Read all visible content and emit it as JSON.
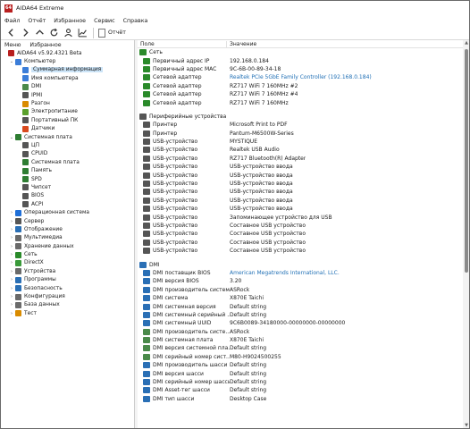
{
  "window": {
    "title": "AIDA64 Extreme"
  },
  "menubar": [
    "Файл",
    "Отчёт",
    "Избранное",
    "Сервис",
    "Справка"
  ],
  "toolbar": {
    "report_label": "Отчёт"
  },
  "left_panel": {
    "tabs": [
      "Меню",
      "Избранное"
    ],
    "tree": [
      {
        "label": "AIDA64 v5.92.4321 Beta",
        "indent": 0,
        "expander": "",
        "color": "#b81f1f",
        "selected": false
      },
      {
        "label": "Компьютер",
        "indent": 1,
        "expander": "⌄",
        "color": "#3b7dd8",
        "selected": false
      },
      {
        "label": "Суммарная информация",
        "indent": 2,
        "expander": "",
        "color": "#3b7dd8",
        "selected": true
      },
      {
        "label": "Имя компьютера",
        "indent": 2,
        "expander": "",
        "color": "#3b7dd8",
        "selected": false
      },
      {
        "label": "DMI",
        "indent": 2,
        "expander": "",
        "color": "#4a8a4a",
        "selected": false
      },
      {
        "label": "IPMI",
        "indent": 2,
        "expander": "",
        "color": "#555555",
        "selected": false
      },
      {
        "label": "Разгон",
        "indent": 2,
        "expander": "",
        "color": "#d98b00",
        "selected": false
      },
      {
        "label": "Электропитание",
        "indent": 2,
        "expander": "",
        "color": "#5aa02c",
        "selected": false
      },
      {
        "label": "Портативный ПК",
        "indent": 2,
        "expander": "",
        "color": "#555555",
        "selected": false
      },
      {
        "label": "Датчики",
        "indent": 2,
        "expander": "",
        "color": "#d94a1f",
        "selected": false
      },
      {
        "label": "Системная плата",
        "indent": 1,
        "expander": "⌄",
        "color": "#2e7d32",
        "selected": false
      },
      {
        "label": "ЦП",
        "indent": 2,
        "expander": "",
        "color": "#555555",
        "selected": false
      },
      {
        "label": "CPUID",
        "indent": 2,
        "expander": "",
        "color": "#555555",
        "selected": false
      },
      {
        "label": "Системная плата",
        "indent": 2,
        "expander": "",
        "color": "#2e7d32",
        "selected": false
      },
      {
        "label": "Память",
        "indent": 2,
        "expander": "",
        "color": "#2e7d32",
        "selected": false
      },
      {
        "label": "SPD",
        "indent": 2,
        "expander": "",
        "color": "#2e7d32",
        "selected": false
      },
      {
        "label": "Чипсет",
        "indent": 2,
        "expander": "",
        "color": "#555555",
        "selected": false
      },
      {
        "label": "BIOS",
        "indent": 2,
        "expander": "",
        "color": "#555555",
        "selected": false
      },
      {
        "label": "ACPI",
        "indent": 2,
        "expander": "",
        "color": "#555555",
        "selected": false
      },
      {
        "label": "Операционная система",
        "indent": 1,
        "expander": "›",
        "color": "#1f6fd8",
        "selected": false
      },
      {
        "label": "Сервер",
        "indent": 1,
        "expander": "›",
        "color": "#555555",
        "selected": false
      },
      {
        "label": "Отображение",
        "indent": 1,
        "expander": "›",
        "color": "#2a6fb5",
        "selected": false
      },
      {
        "label": "Мультимедиа",
        "indent": 1,
        "expander": "›",
        "color": "#6a6a6a",
        "selected": false
      },
      {
        "label": "Хранение данных",
        "indent": 1,
        "expander": "›",
        "color": "#6a6a6a",
        "selected": false
      },
      {
        "label": "Сеть",
        "indent": 1,
        "expander": "›",
        "color": "#2a8a2a",
        "selected": false
      },
      {
        "label": "DirectX",
        "indent": 1,
        "expander": "›",
        "color": "#3a9a3a",
        "selected": false
      },
      {
        "label": "Устройства",
        "indent": 1,
        "expander": "›",
        "color": "#6a6a6a",
        "selected": false
      },
      {
        "label": "Программы",
        "indent": 1,
        "expander": "›",
        "color": "#2a6fb5",
        "selected": false
      },
      {
        "label": "Безопасность",
        "indent": 1,
        "expander": "›",
        "color": "#2a6fb5",
        "selected": false
      },
      {
        "label": "Конфигурация",
        "indent": 1,
        "expander": "›",
        "color": "#6a6a6a",
        "selected": false
      },
      {
        "label": "База данных",
        "indent": 1,
        "expander": "›",
        "color": "#6a6a6a",
        "selected": false
      },
      {
        "label": "Тест",
        "indent": 1,
        "expander": "›",
        "color": "#d98b00",
        "selected": false
      }
    ]
  },
  "table": {
    "col_field": "Поле",
    "col_value": "Значение",
    "sections": [
      {
        "title": "Сеть",
        "color": "#2a8a2a",
        "rows": [
          {
            "field": "Первичный адрес IP",
            "value": "192.168.0.184",
            "link": false,
            "color": "#2a8a2a"
          },
          {
            "field": "Первичный адрес MAC",
            "value": "9C-6B-00-89-34-18",
            "link": false,
            "color": "#2a8a2a"
          },
          {
            "field": "Сетевой адаптер",
            "value": "Realtek PCIe 5GbE Family Controller  (192.168.0.184)",
            "link": true,
            "color": "#2a8a2a"
          },
          {
            "field": "Сетевой адаптер",
            "value": "RZ717 WiFi 7 160MHz #2",
            "link": false,
            "color": "#2a8a2a"
          },
          {
            "field": "Сетевой адаптер",
            "value": "RZ717 WiFi 7 160MHz #4",
            "link": false,
            "color": "#2a8a2a"
          },
          {
            "field": "Сетевой адаптер",
            "value": "RZ717 WiFi 7 160MHz",
            "link": false,
            "color": "#2a8a2a"
          }
        ]
      },
      {
        "title": "Периферийные устройства",
        "color": "#555555",
        "rows": [
          {
            "field": "Принтер",
            "value": "Microsoft Print to PDF",
            "link": false,
            "color": "#555555"
          },
          {
            "field": "Принтер",
            "value": "Pantum-M6500W-Series",
            "link": false,
            "color": "#555555"
          },
          {
            "field": "USB-устройство",
            "value": "MYSTIQUE",
            "link": false,
            "color": "#555555"
          },
          {
            "field": "USB-устройство",
            "value": "Realtek USB Audio",
            "link": false,
            "color": "#555555"
          },
          {
            "field": "USB-устройство",
            "value": "RZ717 Bluetooth(R) Adapter",
            "link": false,
            "color": "#555555"
          },
          {
            "field": "USB-устройство",
            "value": "USB-устройство ввода",
            "link": false,
            "color": "#555555"
          },
          {
            "field": "USB-устройство",
            "value": "USB-устройство ввода",
            "link": false,
            "color": "#555555"
          },
          {
            "field": "USB-устройство",
            "value": "USB-устройство ввода",
            "link": false,
            "color": "#555555"
          },
          {
            "field": "USB-устройство",
            "value": "USB-устройство ввода",
            "link": false,
            "color": "#555555"
          },
          {
            "field": "USB-устройство",
            "value": "USB-устройство ввода",
            "link": false,
            "color": "#555555"
          },
          {
            "field": "USB-устройство",
            "value": "USB-устройство ввода",
            "link": false,
            "color": "#555555"
          },
          {
            "field": "USB-устройство",
            "value": "Запоминающее устройство для USB",
            "link": false,
            "color": "#555555"
          },
          {
            "field": "USB-устройство",
            "value": "Составное USB устройство",
            "link": false,
            "color": "#555555"
          },
          {
            "field": "USB-устройство",
            "value": "Составное USB устройство",
            "link": false,
            "color": "#555555"
          },
          {
            "field": "USB-устройство",
            "value": "Составное USB устройство",
            "link": false,
            "color": "#555555"
          },
          {
            "field": "USB-устройство",
            "value": "Составное USB устройство",
            "link": false,
            "color": "#555555"
          }
        ]
      },
      {
        "title": "DMI",
        "color": "#2a6fb5",
        "rows": [
          {
            "field": "DMI поставщик BIOS",
            "value": "American Megatrends International, LLC.",
            "link": true,
            "color": "#2a6fb5"
          },
          {
            "field": "DMI версия BIOS",
            "value": "3.20",
            "link": false,
            "color": "#2a6fb5"
          },
          {
            "field": "DMI производитель системы",
            "value": "ASRock",
            "link": false,
            "color": "#2a6fb5"
          },
          {
            "field": "DMI система",
            "value": "X870E Taichi",
            "link": false,
            "color": "#2a6fb5"
          },
          {
            "field": "DMI системная версия",
            "value": "Default string",
            "link": false,
            "color": "#2a6fb5"
          },
          {
            "field": "DMI системный серийный ...",
            "value": "Default string",
            "link": false,
            "color": "#2a6fb5"
          },
          {
            "field": "DMI системный UUID",
            "value": "9C6B0089-34180000-00000000-00000000",
            "link": false,
            "color": "#2a6fb5"
          },
          {
            "field": "DMI производитель систе...",
            "value": "ASRock",
            "link": false,
            "color": "#4a8a4a"
          },
          {
            "field": "DMI системная плата",
            "value": "X870E Taichi",
            "link": false,
            "color": "#4a8a4a"
          },
          {
            "field": "DMI версия системной пла...",
            "value": "Default string",
            "link": false,
            "color": "#4a8a4a"
          },
          {
            "field": "DMI серийный номер сист...",
            "value": "M80-H9024500255",
            "link": false,
            "color": "#4a8a4a"
          },
          {
            "field": "DMI производитель шасси",
            "value": "Default string",
            "link": false,
            "color": "#2a6fb5"
          },
          {
            "field": "DMI версия шасси",
            "value": "Default string",
            "link": false,
            "color": "#2a6fb5"
          },
          {
            "field": "DMI серийный номер шасси",
            "value": "Default string",
            "link": false,
            "color": "#2a6fb5"
          },
          {
            "field": "DMI Asset-тег шасси",
            "value": "Default string",
            "link": false,
            "color": "#2a6fb5"
          },
          {
            "field": "DMI тип шасси",
            "value": "Desktop Case",
            "link": false,
            "color": "#2a6fb5"
          }
        ]
      }
    ]
  }
}
